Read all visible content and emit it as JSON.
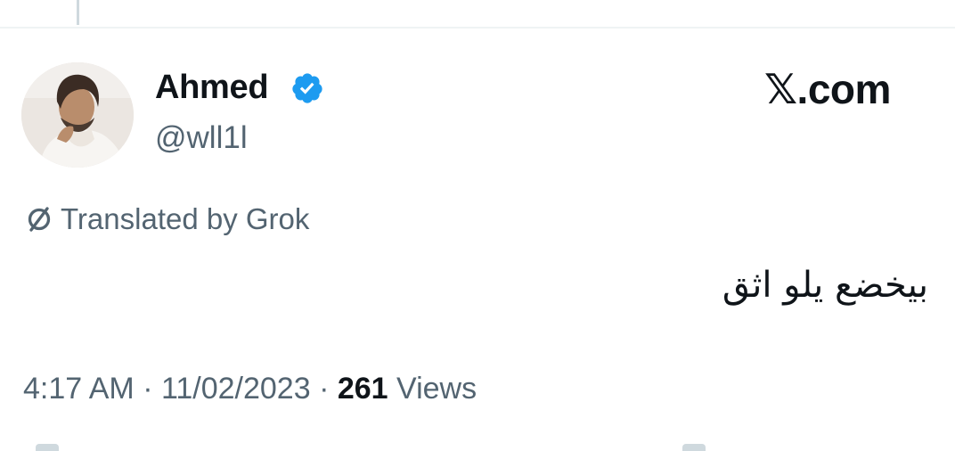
{
  "author": {
    "display_name": "Ahmed",
    "handle": "@wll1l",
    "verified": true,
    "verified_color": "#1d9bf0",
    "avatar": "profile-photo"
  },
  "brand": {
    "label": "𝕏.com"
  },
  "translation": {
    "icon": "translate-slash-icon",
    "label": "Translated by Grok"
  },
  "tweet": {
    "text": "بيخضع يلو اثق"
  },
  "meta": {
    "time": "4:17 AM",
    "separator": " · ",
    "date": "11/02/2023",
    "views_count": "261",
    "views_label": "Views"
  },
  "colors": {
    "text_primary": "#0f1419",
    "text_secondary": "#536471",
    "divider": "#eff3f4"
  }
}
